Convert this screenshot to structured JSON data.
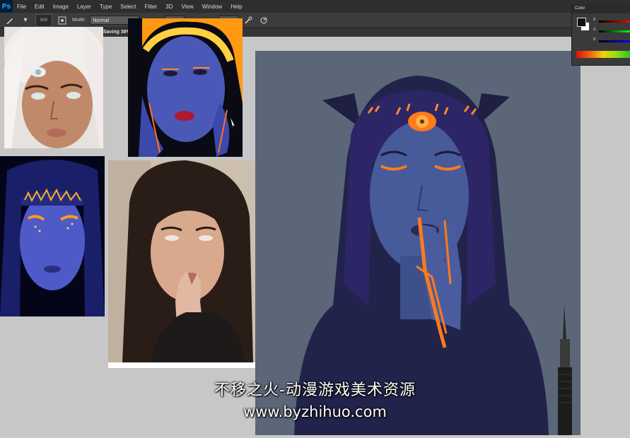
{
  "app": {
    "name": "Photoshop",
    "logo_text": "Ps"
  },
  "menubar": {
    "items": [
      "File",
      "Edit",
      "Image",
      "Layer",
      "Type",
      "Select",
      "Filter",
      "3D",
      "View",
      "Window",
      "Help"
    ]
  },
  "options_bar": {
    "brush_size": "500",
    "mode_label": "Mode:",
    "mode_value": "Normal"
  },
  "document": {
    "status_text": "Saving 38%"
  },
  "color_panel": {
    "tab_label": "Color",
    "sliders": [
      "R",
      "G",
      "B"
    ],
    "foreground": "#111111",
    "background": "#ffffff"
  },
  "watermark": {
    "line1": "不移之火-动漫游戏美术资源",
    "line2": "www.byzhihuo.com"
  },
  "colors": {
    "neon_orange": "#ff7a1a",
    "uv_blue": "#3a3fc0",
    "painting_bg": "#5b6678"
  },
  "icons": [
    "brush-icon",
    "airbrush-icon",
    "pressure-icon"
  ]
}
